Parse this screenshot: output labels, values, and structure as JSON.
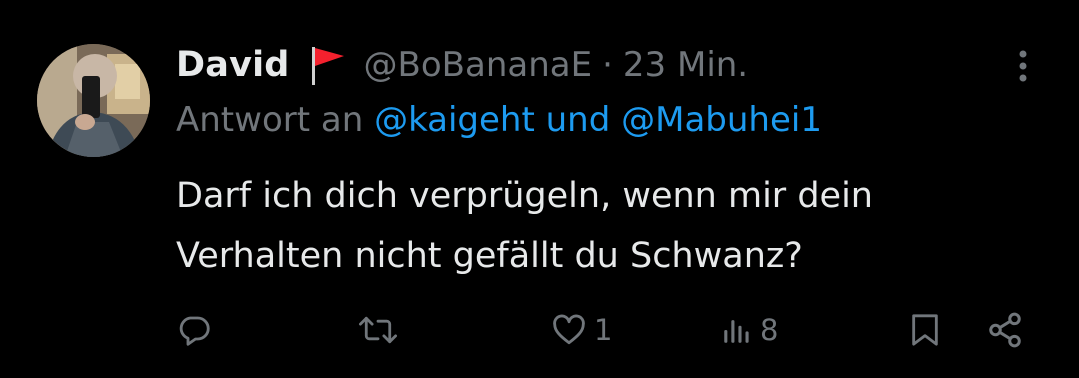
{
  "tweet": {
    "author_name": "David",
    "author_handle": "@BoBananaE",
    "separator": "·",
    "timestamp": "23 Min.",
    "reply_prefix": "Antwort an",
    "reply_targets": "@kaigeht und @Mabuhei1",
    "text_lines": [
      "Darf ich dich verprügeln, wenn mir dein",
      "Verhalten nicht gefällt du Schwanz?"
    ],
    "likes": "1",
    "views": "8"
  },
  "icons": {
    "badge": "red-flag-icon",
    "more": "more-vertical-icon",
    "reply": "reply-icon",
    "retweet": "retweet-icon",
    "like": "heart-icon",
    "views": "views-icon",
    "bookmark": "bookmark-icon",
    "share": "share-icon"
  },
  "colors": {
    "background": "#000000",
    "primary_text": "#e7e9ea",
    "secondary_text": "#71767b",
    "link": "#1d9bf0",
    "flag": "#f4212e"
  }
}
